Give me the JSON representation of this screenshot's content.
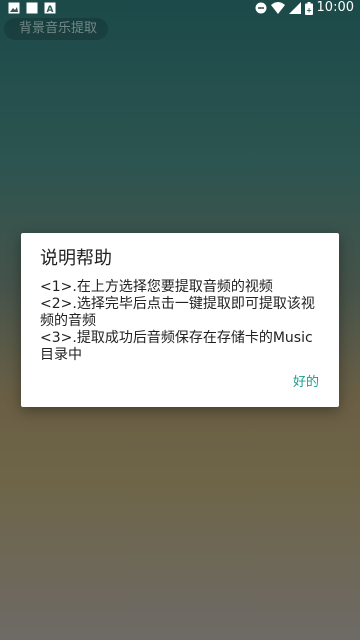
{
  "status_bar": {
    "time": "10:00",
    "icons": [
      "image-icon",
      "square-icon",
      "text-a-icon",
      "do-not-disturb-icon",
      "wifi-icon",
      "signal-icon",
      "battery-icon"
    ]
  },
  "app": {
    "title": "背景音乐提取"
  },
  "dialog": {
    "title": "说明帮助",
    "lines": [
      "<1>.在上方选择您要提取音频的视频",
      "<2>.选择完毕后点击一键提取即可提取该视频的音频",
      "<3>.提取成功后音频保存在存储卡的Music目录中"
    ],
    "ok_label": "好的"
  },
  "colors": {
    "accent": "#1b9c8f",
    "dialog_bg": "#ffffff"
  }
}
